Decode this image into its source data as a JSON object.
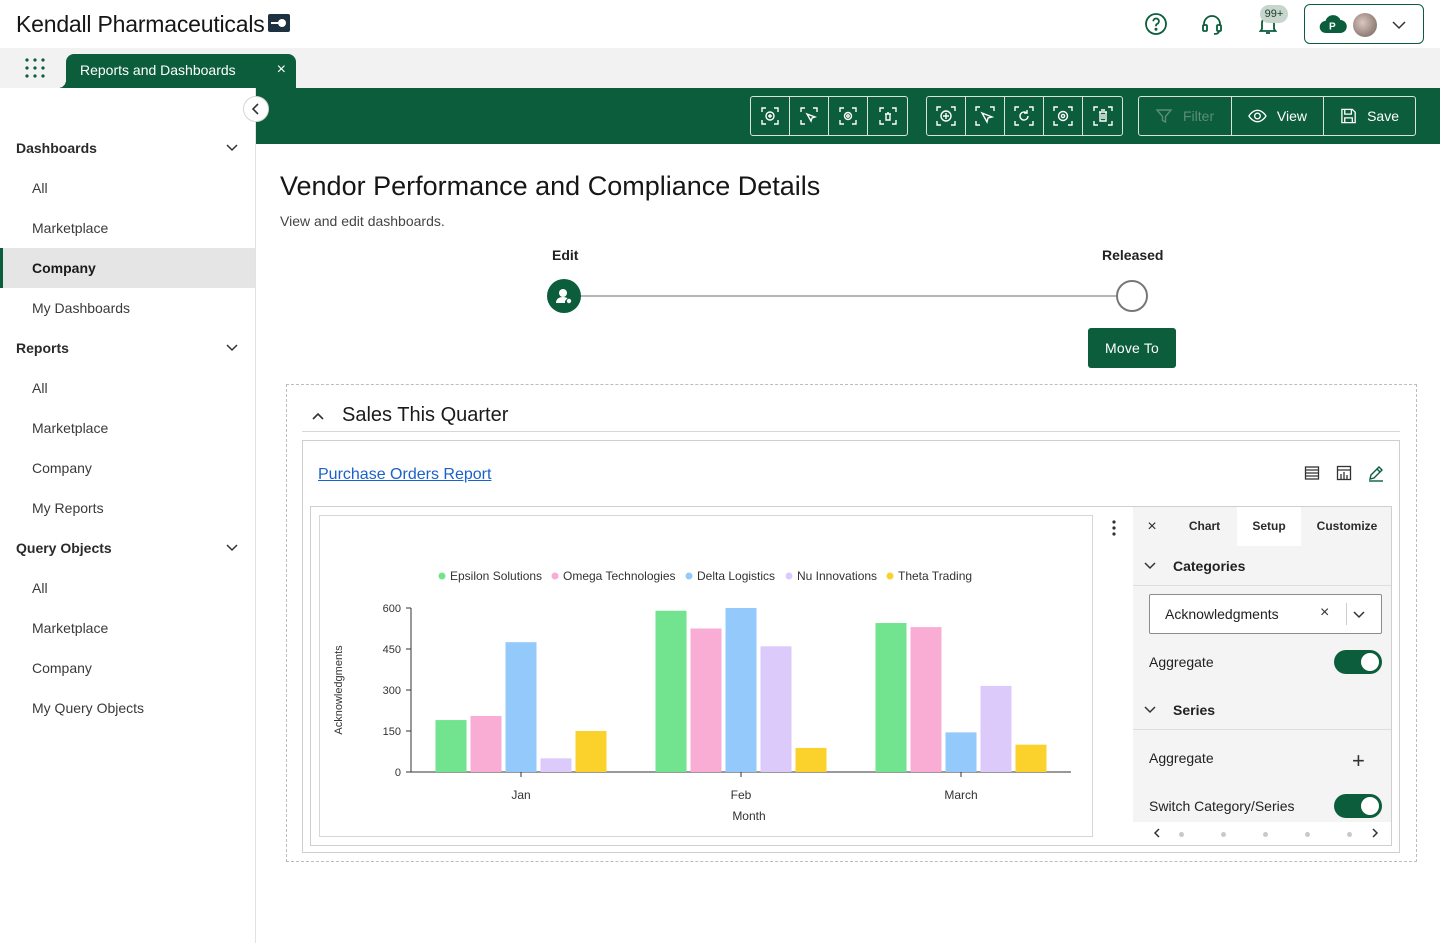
{
  "app": {
    "brand": "Kendall Pharmaceuticals",
    "notification_count": "99+"
  },
  "tabs": [
    {
      "label": "Reports and Dashboards",
      "close": "×"
    }
  ],
  "sidebar": {
    "sections": [
      {
        "label": "Dashboards",
        "items": [
          "All",
          "Marketplace",
          "Company",
          "My Dashboards"
        ]
      },
      {
        "label": "Reports",
        "items": [
          "All",
          "Marketplace",
          "Company",
          "My Reports"
        ]
      },
      {
        "label": "Query Objects",
        "items": [
          "All",
          "Marketplace",
          "Company",
          "My Query Objects"
        ]
      }
    ],
    "active": "Dashboards/Company"
  },
  "toolbar": {
    "filter_label": "Filter",
    "view_label": "View",
    "save_label": "Save"
  },
  "page": {
    "title": "Vendor Performance and Compliance Details",
    "subtitle": "View and edit dashboards.",
    "steps": [
      {
        "label": "Edit",
        "state": "current"
      },
      {
        "label": "Released",
        "state": "pending"
      }
    ],
    "move_button": "Move To"
  },
  "section": {
    "title": "Sales This Quarter",
    "report_link": "Purchase Orders Report"
  },
  "chart_data": {
    "type": "bar",
    "categories": [
      "Jan",
      "Feb",
      "March"
    ],
    "series": [
      {
        "name": "Epsilon Solutions",
        "color": "#72e38e",
        "values": [
          190,
          590,
          545
        ]
      },
      {
        "name": "Omega Technologies",
        "color": "#f9acd4",
        "values": [
          205,
          525,
          530
        ]
      },
      {
        "name": "Delta Logistics",
        "color": "#94c9fb",
        "values": [
          475,
          600,
          145
        ]
      },
      {
        "name": "Nu Innovations",
        "color": "#dccafb",
        "values": [
          50,
          460,
          315
        ]
      },
      {
        "name": "Theta Trading",
        "color": "#fbd12c",
        "values": [
          150,
          88,
          100
        ]
      }
    ],
    "yticks": [
      0,
      150,
      300,
      450,
      600
    ],
    "ylim": [
      0,
      600
    ],
    "xlabel": "Month",
    "ylabel": "Acknowledgments",
    "legend": "top",
    "grid": false
  },
  "panel": {
    "close": "×",
    "tabs": [
      "Chart",
      "Setup",
      "Customize"
    ],
    "active_tab": "Setup",
    "categories_label": "Categories",
    "category_value": "Acknowledgments",
    "aggregate_label": "Aggregate",
    "series_label": "Series",
    "series_aggregate_label": "Aggregate",
    "switch_label": "Switch Category/Series",
    "clear": "×",
    "add": "+"
  }
}
